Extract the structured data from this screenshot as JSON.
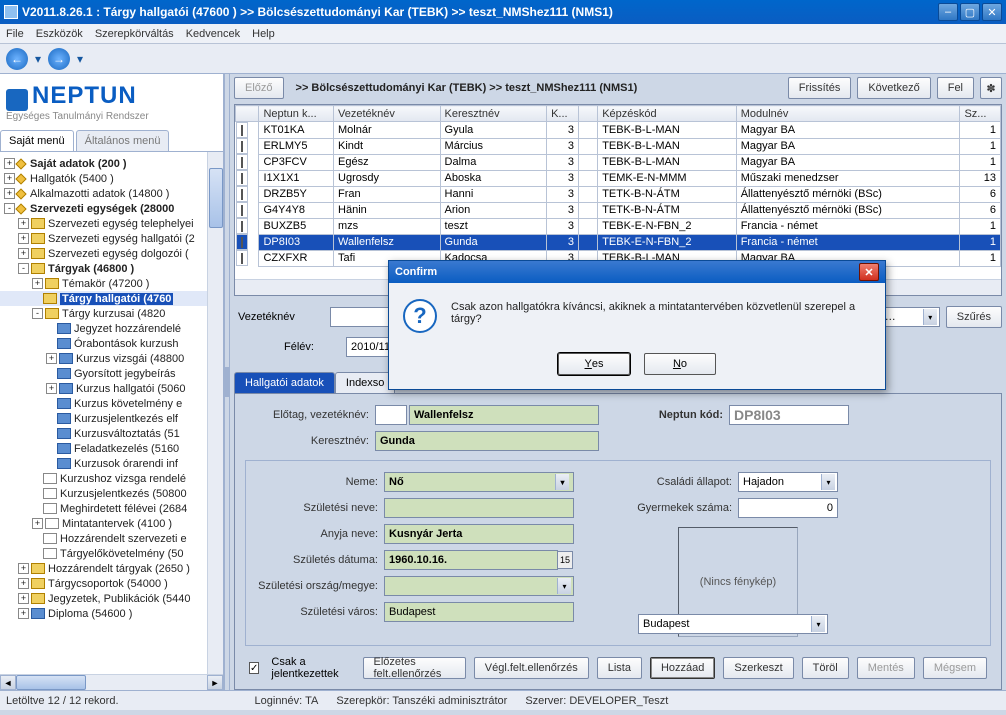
{
  "title": "V2011.8.26.1 : Tárgy hallgatói (47600  )  >> Bölcsészettudományi Kar (TEBK) >> teszt_NMShez111 (NMS1)",
  "menu": [
    "File",
    "Eszközök",
    "Szerepkörváltás",
    "Kedvencek",
    "Help"
  ],
  "logo_brand": "NEPTUN",
  "logo_sub": "Egységes Tanulmányi Rendszer",
  "left_tabs": {
    "own": "Saját menü",
    "general": "Általános menü"
  },
  "tree": [
    {
      "depth": 0,
      "exp": "+",
      "icon": "diamond",
      "label": "Saját adatok (200  )",
      "bold": true
    },
    {
      "depth": 0,
      "exp": "+",
      "icon": "diamond",
      "label": "Hallgatók (5400  )"
    },
    {
      "depth": 0,
      "exp": "+",
      "icon": "diamond",
      "label": "Alkalmazotti adatok (14800  )"
    },
    {
      "depth": 0,
      "exp": "-",
      "icon": "diamond",
      "label": "Szervezeti egységek (28000",
      "bold": true
    },
    {
      "depth": 1,
      "exp": "+",
      "icon": "folder",
      "label": "Szervezeti egység telephelyei"
    },
    {
      "depth": 1,
      "exp": "+",
      "icon": "folder",
      "label": "Szervezeti egység hallgatói (2"
    },
    {
      "depth": 1,
      "exp": "+",
      "icon": "folder",
      "label": "Szervezeti egység dolgozói ("
    },
    {
      "depth": 1,
      "exp": "-",
      "icon": "folder",
      "label": "Tárgyak (46800  )",
      "bold": true
    },
    {
      "depth": 2,
      "exp": "+",
      "icon": "folder",
      "label": "Témakör (47200  )"
    },
    {
      "depth": 2,
      "exp": "",
      "icon": "folder",
      "label": "Tárgy hallgatói (4760",
      "bold": true,
      "sel": true
    },
    {
      "depth": 2,
      "exp": "-",
      "icon": "folder",
      "label": "Tárgy kurzusai (4820"
    },
    {
      "depth": 3,
      "exp": "",
      "icon": "bluebox",
      "label": "Jegyzet hozzárendelé"
    },
    {
      "depth": 3,
      "exp": "",
      "icon": "bluebox",
      "label": "Órabontások kurzush"
    },
    {
      "depth": 3,
      "exp": "+",
      "icon": "bluebox",
      "label": "Kurzus vizsgái (48800"
    },
    {
      "depth": 3,
      "exp": "",
      "icon": "bluebox",
      "label": "Gyorsított jegybeírás"
    },
    {
      "depth": 3,
      "exp": "+",
      "icon": "bluebox",
      "label": "Kurzus hallgatói (5060"
    },
    {
      "depth": 3,
      "exp": "",
      "icon": "bluebox",
      "label": "Kurzus követelmény e"
    },
    {
      "depth": 3,
      "exp": "",
      "icon": "bluebox",
      "label": "Kurzusjelentkezés elf"
    },
    {
      "depth": 3,
      "exp": "",
      "icon": "bluebox",
      "label": "Kurzusváltoztatás (51"
    },
    {
      "depth": 3,
      "exp": "",
      "icon": "bluebox",
      "label": "Feladatkezelés (5160"
    },
    {
      "depth": 3,
      "exp": "",
      "icon": "bluebox",
      "label": "Kurzusok órarendi inf"
    },
    {
      "depth": 2,
      "exp": "",
      "icon": "page",
      "label": "Kurzushoz vizsga rendelé"
    },
    {
      "depth": 2,
      "exp": "",
      "icon": "page",
      "label": "Kurzusjelentkezés (50800"
    },
    {
      "depth": 2,
      "exp": "",
      "icon": "page",
      "label": "Meghirdetett félévei (2684"
    },
    {
      "depth": 2,
      "exp": "+",
      "icon": "page",
      "label": "Mintatantervek (4100  )"
    },
    {
      "depth": 2,
      "exp": "",
      "icon": "page",
      "label": "Hozzárendelt szervezeti e"
    },
    {
      "depth": 2,
      "exp": "",
      "icon": "page",
      "label": "Tárgyelőkövetelmény (50"
    },
    {
      "depth": 1,
      "exp": "+",
      "icon": "folder",
      "label": "Hozzárendelt tárgyak (2650  )"
    },
    {
      "depth": 1,
      "exp": "+",
      "icon": "folder",
      "label": "Tárgycsoportok (54000  )"
    },
    {
      "depth": 1,
      "exp": "+",
      "icon": "folder",
      "label": "Jegyzetek, Publikációk (5440"
    },
    {
      "depth": 1,
      "exp": "+",
      "icon": "bluebox",
      "label": "Diploma (54600  )"
    }
  ],
  "right": {
    "prev": "Előző",
    "crumb": ">> Bölcsészettudományi Kar (TEBK) >> teszt_NMShez111 (NMS1)",
    "refresh": "Frissítés",
    "next": "Következő",
    "up": "Fel"
  },
  "grid": {
    "cols": [
      "",
      "Neptun k...",
      "Vezetéknév",
      "Keresztnév",
      "K...",
      "",
      "Képzéskód",
      "Modulnév",
      "Sz..."
    ],
    "rows": [
      [
        "",
        "KT01KA",
        "Molnár",
        "Gyula",
        "3",
        "",
        "TEBK-B-L-MAN",
        "Magyar BA",
        "1"
      ],
      [
        "",
        "ERLMY5",
        "Kindt",
        "Március",
        "3",
        "",
        "TEBK-B-L-MAN",
        "Magyar BA",
        "1"
      ],
      [
        "",
        "CP3FCV",
        "Egész",
        "Dalma",
        "3",
        "",
        "TEBK-B-L-MAN",
        "Magyar BA",
        "1"
      ],
      [
        "",
        "I1X1X1",
        "Ugrosdy",
        "Aboska",
        "3",
        "",
        "TEMK-E-N-MMM",
        "Műszaki menedzser",
        "13"
      ],
      [
        "",
        "DRZB5Y",
        "Fran",
        "Hanni",
        "3",
        "",
        "TETK-B-N-ÁTM",
        "Állattenyésztő mérnöki (BSc)",
        "6"
      ],
      [
        "",
        "G4Y4Y8",
        "Hänin",
        "Arion",
        "3",
        "",
        "TETK-B-N-ÁTM",
        "Állattenyésztő mérnöki (BSc)",
        "6"
      ],
      [
        "",
        "BUXZB5",
        "mzs",
        "teszt",
        "3",
        "",
        "TEBK-E-N-FBN_2",
        "Francia - német",
        "1"
      ],
      [
        "",
        "DP8I03",
        "Wallenfelsz",
        "Gunda",
        "3",
        "",
        "TEBK-E-N-FBN_2",
        "Francia - német",
        "1"
      ],
      [
        "",
        "CZXFXR",
        "Tafi",
        "Kadocsa",
        "3",
        "",
        "TEBK-B-L-MAN",
        "Magyar BA",
        "1"
      ]
    ],
    "selected": 7
  },
  "filter": {
    "label": "Vezetéknév",
    "szures": "Szűrés"
  },
  "felev": {
    "label": "Félév:",
    "val": "2010/11"
  },
  "subtabs": [
    "Hallgatói adatok",
    "Indexso"
  ],
  "form": {
    "lbl_veznev": "Előtag, vezetéknév:",
    "veznev": "Wallenfelsz",
    "lbl_nkod": "Neptun kód:",
    "nkod": "DP8I03",
    "lbl_kereszt": "Keresztnév:",
    "kereszt": "Gunda",
    "lbl_neme": "Neme:",
    "neme": "Nő",
    "lbl_csalad": "Családi állapot:",
    "csalad": "Hajadon",
    "lbl_szulnev": "Születési neve:",
    "szulnev": "",
    "lbl_gyerek": "Gyermekek száma:",
    "gyerek": "0",
    "lbl_anyja": "Anyja neve:",
    "anyja": "Kusnyár Jerta",
    "lbl_szuldatum": "Születés dátuma:",
    "szuldatum": "1960.10.16.",
    "lbl_orszag": "Születési ország/megye:",
    "orszag": "",
    "megye": "Budapest",
    "lbl_varos": "Születési város:",
    "varos": "Budapest",
    "nophoto": "(Nincs fénykép)"
  },
  "bottom": {
    "csak": "Csak a jelentkezettek",
    "elozetes": "Előzetes felt.ellenőrzés",
    "vegl": "Végl.felt.ellenőrzés",
    "lista": "Lista",
    "hozzaad": "Hozzáad",
    "szerkeszt": "Szerkeszt",
    "torol": "Töröl",
    "mentes": "Mentés",
    "megsem": "Mégsem"
  },
  "status": {
    "rec": "Letöltve 12 / 12 rekord.",
    "login": "Loginnév: TA",
    "role": "Szerepkör: Tanszéki adminisztrátor",
    "server": "Szerver: DEVELOPER_Teszt"
  },
  "dialog": {
    "title": "Confirm",
    "text": "Csak azon hallgatókra kíváncsi, akiknek a mintatantervében közvetlenül szerepel a tárgy?",
    "yes": "Yes",
    "no": "No"
  }
}
